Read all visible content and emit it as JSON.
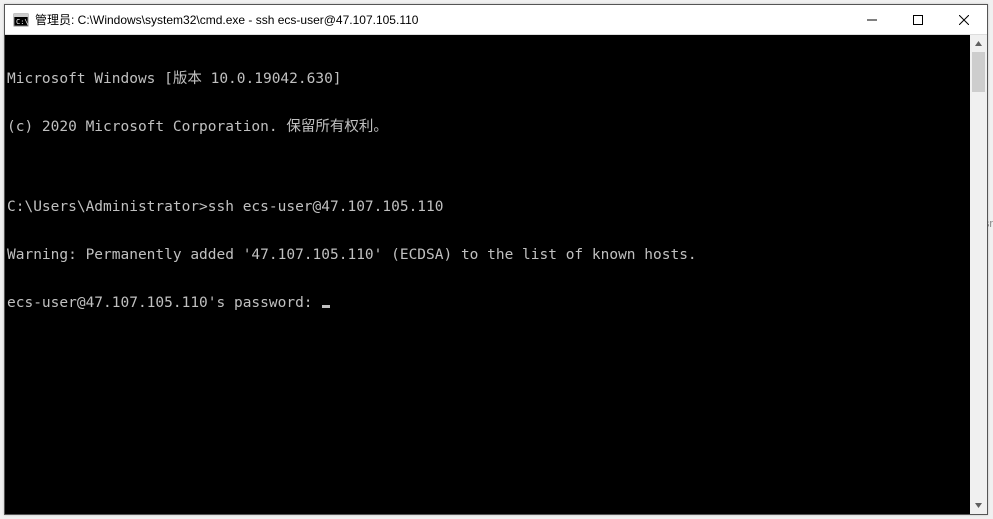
{
  "window": {
    "title": "管理员: C:\\Windows\\system32\\cmd.exe - ssh  ecs-user@47.107.105.110"
  },
  "terminal": {
    "lines": [
      "Microsoft Windows [版本 10.0.19042.630]",
      "(c) 2020 Microsoft Corporation. 保留所有权利。",
      "",
      "C:\\Users\\Administrator>ssh ecs-user@47.107.105.110",
      "Warning: Permanently added '47.107.105.110' (ECDSA) to the list of known hosts.",
      "ecs-user@47.107.105.110's password: "
    ]
  },
  "bg_text": "sr"
}
